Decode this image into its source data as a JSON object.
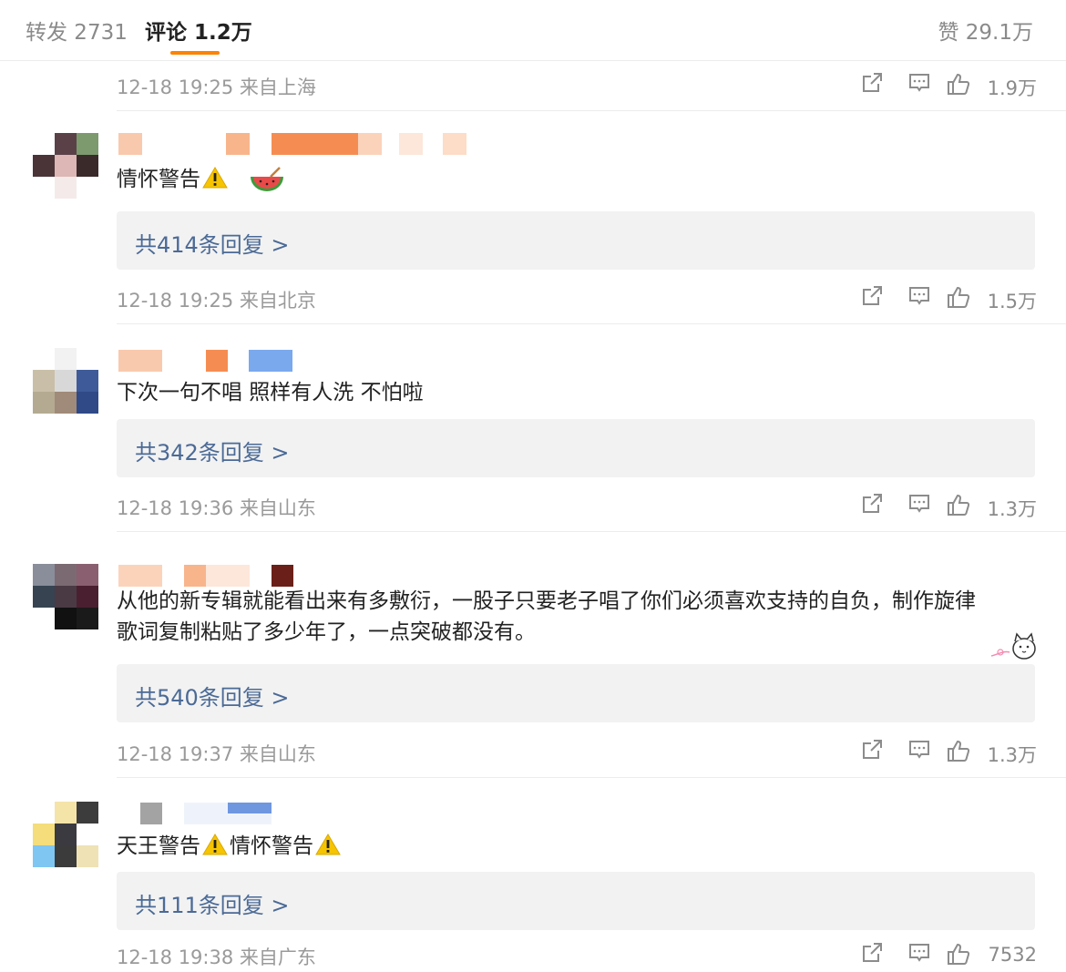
{
  "tabs": {
    "repost": "转发 2731",
    "comment": "评论 1.2万",
    "likes": "赞 29.1万"
  },
  "icons": {
    "share": "share-icon",
    "reply": "comment-icon",
    "like": "thumbs-up-icon",
    "warning": "warning-icon",
    "watermelon": "watermelon-emoji-icon",
    "sticker": "cat-sticker-icon"
  },
  "colors": {
    "accent": "#ff8200",
    "link": "#4b6a96",
    "meta": "#9a9a9a"
  },
  "top_meta": {
    "time": "12-18 19:25 来自上海",
    "likes": "1.9万"
  },
  "comments": [
    {
      "text": "情怀警告",
      "replies": "共414条回复 >",
      "time": "12-18 19:25 来自北京",
      "likes": "1.5万"
    },
    {
      "text": "下次一句不唱 照样有人洗 不怕啦",
      "replies": "共342条回复 >",
      "time": "12-18 19:36 来自山东",
      "likes": "1.3万"
    },
    {
      "text_line1": "从他的新专辑就能看出来有多敷衍，一股子只要老子唱了你们必须喜欢支持的自负，制作旋律",
      "text_line2": "歌词复制粘贴了多少年了，一点突破都没有。",
      "replies": "共540条回复 >",
      "time": "12-18 19:37 来自山东",
      "likes": "1.3万"
    },
    {
      "text_part1": "天王警告",
      "text_part2": "情怀警告",
      "replies": "共111条回复 >",
      "time": "12-18 19:38 来自广东",
      "likes": "7532"
    }
  ]
}
